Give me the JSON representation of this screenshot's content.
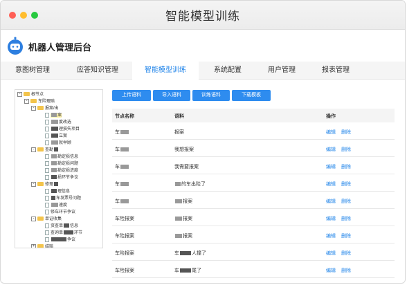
{
  "window": {
    "title": "智能模型训练"
  },
  "header": {
    "app_name": "机器人管理后台",
    "logo_icon": "robot-icon"
  },
  "nav": {
    "tabs": [
      {
        "label": "意图树管理",
        "active": false
      },
      {
        "label": "应答知识管理",
        "active": false
      },
      {
        "label": "智能模型训练",
        "active": true
      },
      {
        "label": "系统配置",
        "active": false
      },
      {
        "label": "用户管理",
        "active": false
      },
      {
        "label": "报表管理",
        "active": false
      }
    ]
  },
  "tree": {
    "root": "根节点",
    "car_claims": "车险理赔",
    "report": "报案/出",
    "report_child_label": "案",
    "n1": "度改选",
    "n2": "理损失项目",
    "n3": "立案",
    "n4": "就举顾",
    "query": "查勘",
    "q1": "勘定损信息",
    "q2": "勘定损问题",
    "q3": "勘定损进度",
    "q4": "损环节争议",
    "repair": "修理",
    "r1": "理信息",
    "r2": "车发票号问题",
    "r3": "速度",
    "r4": "修车环节争议",
    "settle": "单证收集",
    "s1": "资查单",
    "s2": "信息",
    "s3": "查询单",
    "s4": "环节",
    "s5": "争议",
    "last": "结赔"
  },
  "toolbar": {
    "upload": "上传语料",
    "import": "导入语料",
    "train": "训练语料",
    "download": "下载模板"
  },
  "table": {
    "headers": {
      "node": "节点名称",
      "corpus": "语料",
      "action": "操作"
    },
    "edit_label": "编辑",
    "delete_label": "删除",
    "rows": [
      {
        "node": "车",
        "corpus": "报案"
      },
      {
        "node": "车",
        "corpus": "我想报案"
      },
      {
        "node": "车",
        "corpus": "我需要报案"
      },
      {
        "node": "车",
        "corpus": "的车出险了"
      },
      {
        "node": "车",
        "corpus": "报案"
      },
      {
        "node": "车险报案",
        "corpus": "报案"
      },
      {
        "node": "车险报案",
        "corpus": "报案"
      },
      {
        "node": "车险报案",
        "corpus": "人撞了"
      },
      {
        "node": "车险报案",
        "corpus": "尾了"
      }
    ]
  }
}
